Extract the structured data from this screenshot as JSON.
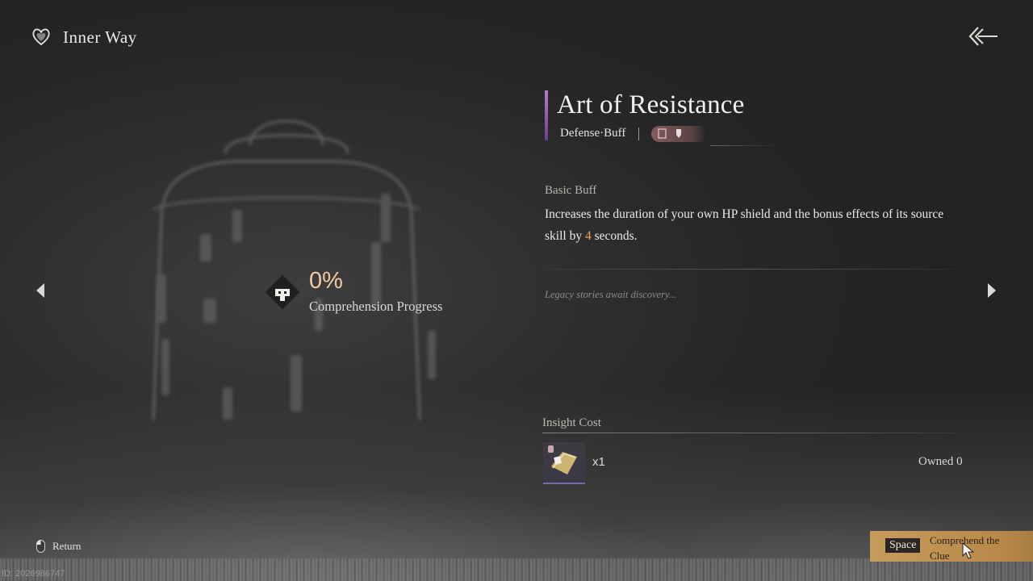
{
  "header": {
    "title": "Inner Way",
    "icon": "heart-emblem-icon"
  },
  "skill": {
    "name": "Art of Resistance",
    "category": "Defense·Buff",
    "accent_color": "#9a5fc4"
  },
  "description": {
    "title": "Basic Buff",
    "text_before": "Increases the duration of your own HP shield and the bonus effects of its source skill by ",
    "value": "4",
    "text_after": " seconds."
  },
  "legacy_text": "Legacy stories await discovery...",
  "progress": {
    "percent": "0%",
    "label": "Comprehension Progress",
    "value": 0
  },
  "insight": {
    "label": "Insight Cost",
    "quantity": "x1",
    "owned": "Owned 0"
  },
  "footer": {
    "return_label": "Return",
    "action_key": "Space",
    "action_label": "Comprehend the Clue",
    "id_text": "ID: 2026986747"
  }
}
